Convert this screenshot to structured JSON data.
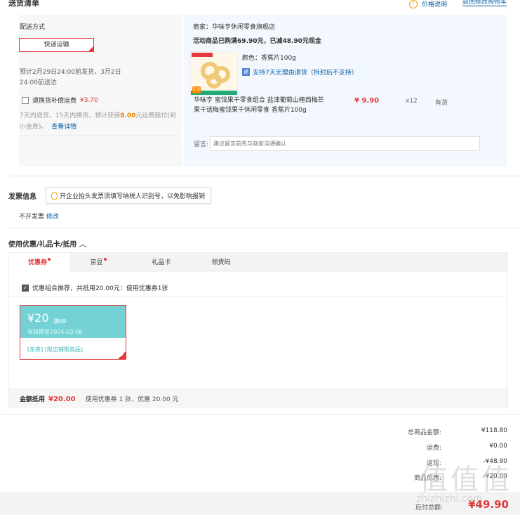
{
  "header": {
    "title": "送货清单",
    "price_info": "价格说明",
    "back_to_cart": "返回修改购物车"
  },
  "shipping": {
    "label": "配送方式",
    "method": "快递运输",
    "eta_line1": "预计2月29日24:00前发货，3月2日",
    "eta_line2": "24:00前送达",
    "insurance_label": "退换货补偿运费",
    "insurance_price": "¥3.70",
    "insurance_desc_a": "7天内退货，15天内换货，预计获得",
    "insurance_desc_amount": "8.00",
    "insurance_desc_b": "元运费赔付(到小金库)。",
    "details_link": "查看详情"
  },
  "store": {
    "merchant": "商家：华味亨休闲零食旗舰店",
    "promo": "活动商品已购满69.90元，已减48.90元现金",
    "product": {
      "color": "颜色：香蕉片100g",
      "return_icon": "退",
      "return_policy": "支持7天无理由退货（拆封后不支持）",
      "name": "华味亨 蜜饯果干零食组合 盐津葡萄山楂西梅芒果干话梅蜜饯果干休闲零食 香蕉片100g",
      "price": "¥ 9.90",
      "qty": "x12",
      "stock": "有货",
      "thumb_badge": "5.9"
    },
    "note_label": "留言:",
    "note_placeholder": "建议留言前先与商家沟通确认"
  },
  "invoice": {
    "title": "发票信息",
    "tip": "开企业抬头发票须填写纳税人识别号，以免影响报销",
    "value": "不开发票",
    "edit": "修改"
  },
  "coupons": {
    "title": "使用优惠/礼品卡/抵用",
    "tabs": [
      "优惠券",
      "京豆",
      "礼品卡",
      "领货码"
    ],
    "combo_label": "优惠组合推荐，共抵用20.00元：使用优惠券1张",
    "card": {
      "amount": "¥20",
      "threshold": "满69",
      "expiry": "有效期至2024-03-06",
      "scope": "[东券] [限店铺限商品]"
    },
    "footer_label": "金额抵用",
    "footer_amount": "¥20.00",
    "footer_desc": "使用优惠券 1 张，优惠 20.00 元"
  },
  "summary": {
    "rows": [
      {
        "label": "总商品金额:",
        "value": "¥118.80"
      },
      {
        "label": "运费:",
        "value": "¥0.00"
      },
      {
        "label": "返现:",
        "value": "-¥48.90"
      },
      {
        "label": "商品优惠:",
        "value": "-¥20.00"
      }
    ],
    "pay_label": "应付总额:",
    "pay_value": "¥49.90"
  },
  "watermark": {
    "logo": "值值值",
    "url": "zhizhizhi.com"
  },
  "colors": {
    "accent": "#e4393c",
    "link": "#005ea7",
    "coupon": "#74d2d5"
  }
}
